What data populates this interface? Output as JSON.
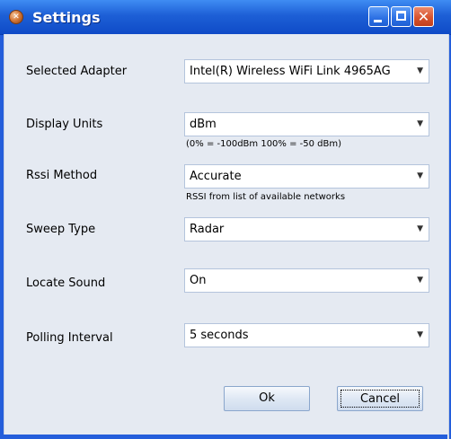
{
  "window": {
    "title": "Settings",
    "icon": "app-orange-icon"
  },
  "fields": [
    {
      "label": "Selected Adapter",
      "value": "Intel(R) Wireless WiFi Link 4965AG",
      "hint": ""
    },
    {
      "label": "Display Units",
      "value": "dBm",
      "hint": "(0% = -100dBm 100% = -50 dBm)"
    },
    {
      "label": "Rssi Method",
      "value": "Accurate",
      "hint": "RSSI from list of available networks"
    },
    {
      "label": "Sweep Type",
      "value": "Radar",
      "hint": ""
    },
    {
      "label": "Locate Sound",
      "value": "On",
      "hint": ""
    },
    {
      "label": "Polling Interval",
      "value": "5 seconds",
      "hint": ""
    }
  ],
  "buttons": {
    "ok": "Ok",
    "cancel": "Cancel"
  },
  "colors": {
    "titlebar": "#1d5fd6",
    "client_bg": "#e5eaf2",
    "close_button": "#d8542f"
  }
}
